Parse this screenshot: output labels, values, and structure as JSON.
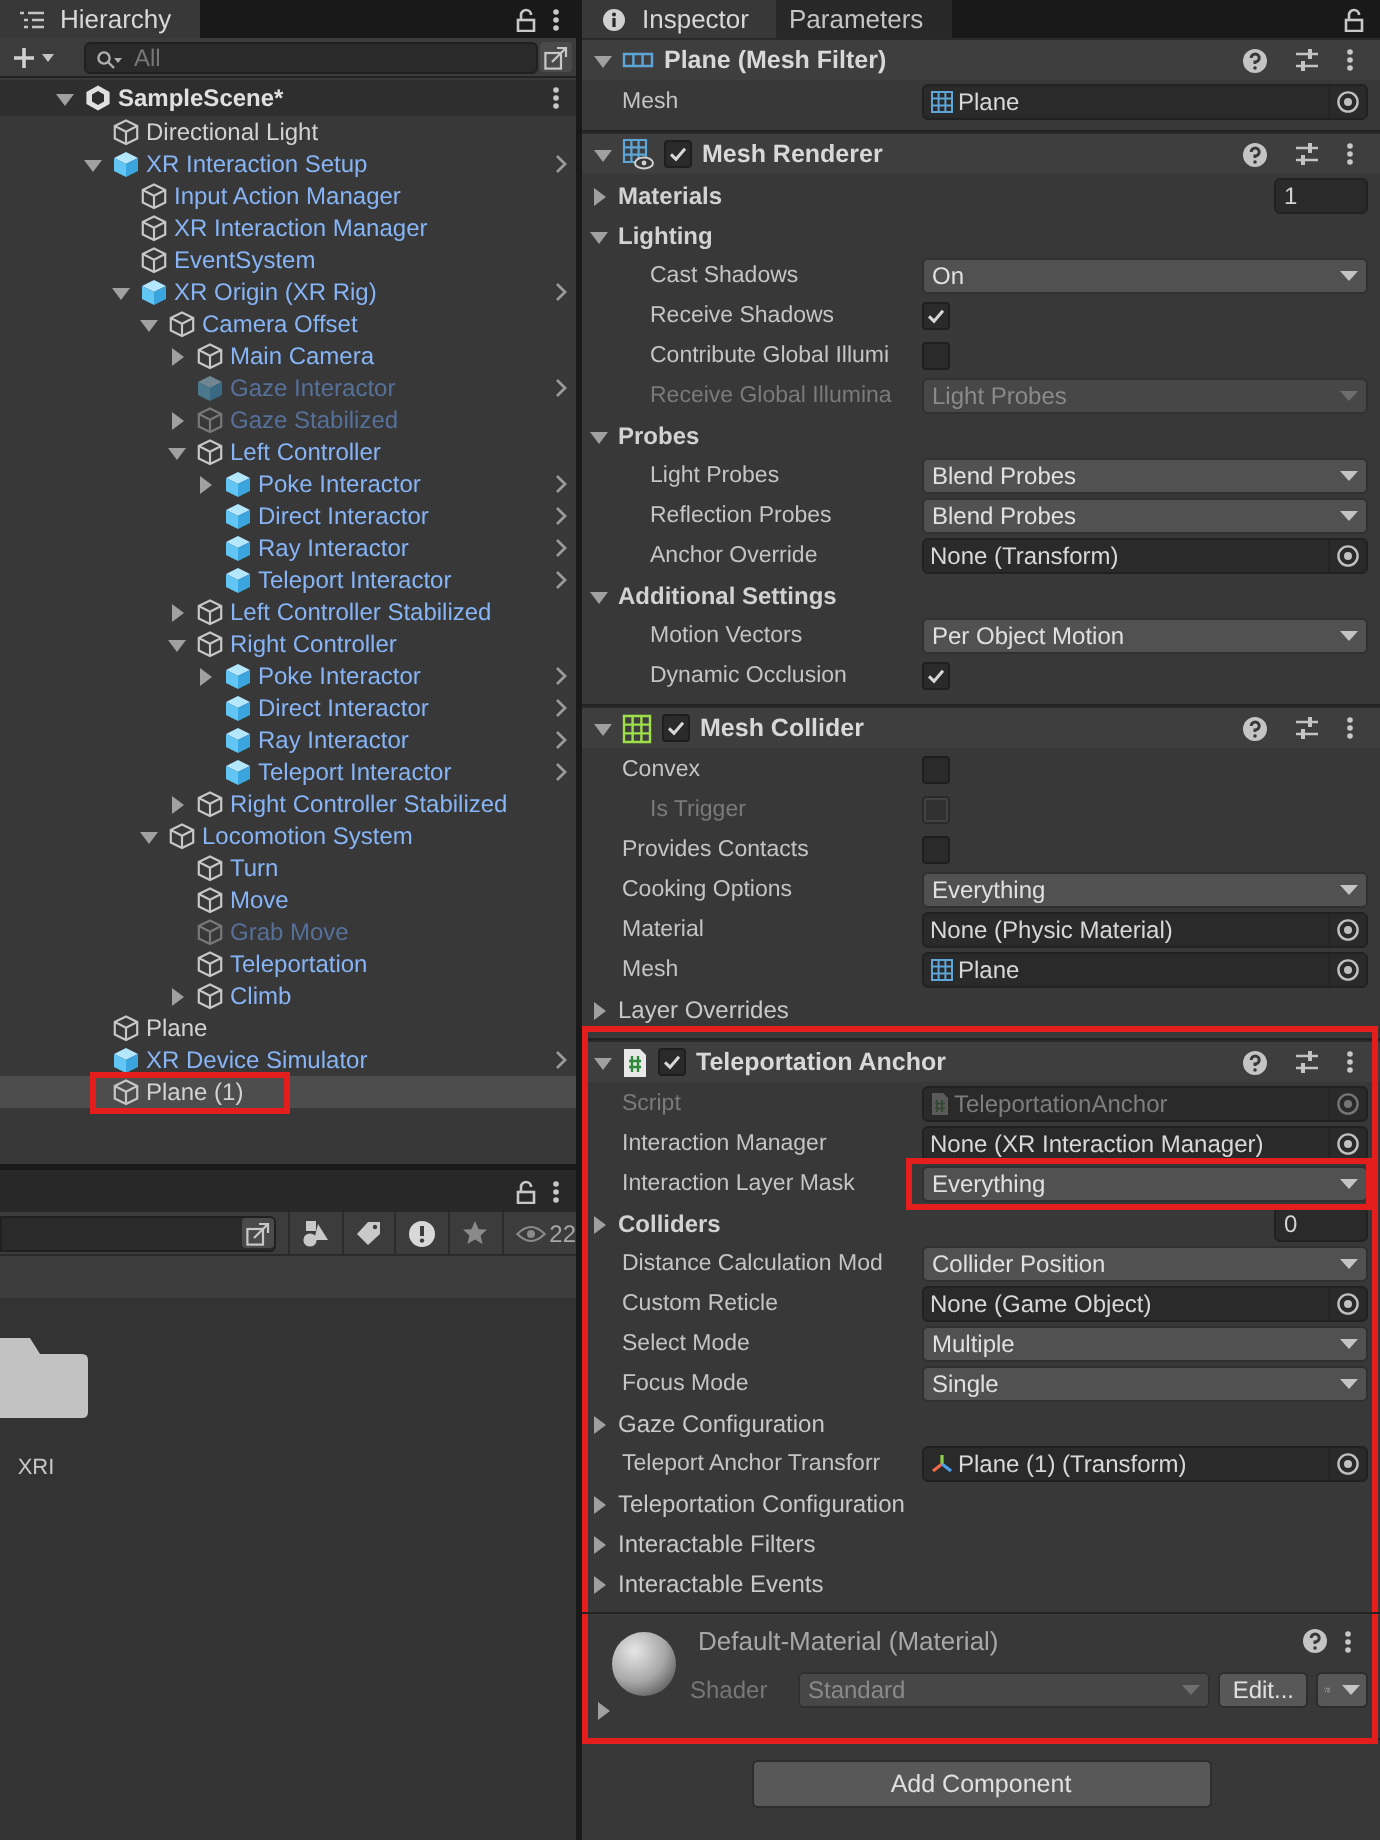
{
  "hierarchy": {
    "tab": {
      "label": "Hierarchy",
      "selected": true
    },
    "search": {
      "placeholder": "All"
    },
    "scene": {
      "name": "SampleScene*",
      "expanded": true,
      "children": [
        {
          "name": "Directional Light",
          "kind": "object",
          "prefab_member": false,
          "active": true,
          "overrides": false,
          "selected": false,
          "annotated": false
        },
        {
          "name": "XR Interaction Setup",
          "kind": "prefab",
          "prefab_member": true,
          "active": true,
          "overrides": true,
          "selected": false,
          "annotated": false,
          "expanded": true,
          "children": [
            {
              "name": "Input Action Manager",
              "kind": "object",
              "prefab_member": true,
              "active": true,
              "overrides": false,
              "selected": false,
              "annotated": false
            },
            {
              "name": "XR Interaction Manager",
              "kind": "object",
              "prefab_member": true,
              "active": true,
              "overrides": false,
              "selected": false,
              "annotated": false
            },
            {
              "name": "EventSystem",
              "kind": "object",
              "prefab_member": true,
              "active": true,
              "overrides": false,
              "selected": false,
              "annotated": false
            },
            {
              "name": "XR Origin (XR Rig)",
              "kind": "prefab",
              "prefab_member": true,
              "active": true,
              "overrides": true,
              "selected": false,
              "annotated": false,
              "expanded": true,
              "children": [
                {
                  "name": "Camera Offset",
                  "kind": "object",
                  "prefab_member": true,
                  "active": true,
                  "overrides": false,
                  "selected": false,
                  "annotated": false,
                  "expanded": true,
                  "children": [
                    {
                      "name": "Main Camera",
                      "kind": "object",
                      "prefab_member": true,
                      "active": true,
                      "overrides": false,
                      "selected": false,
                      "annotated": false,
                      "expanded": false
                    },
                    {
                      "name": "Gaze Interactor",
                      "kind": "prefab",
                      "prefab_member": true,
                      "active": false,
                      "overrides": true,
                      "selected": false,
                      "annotated": false
                    },
                    {
                      "name": "Gaze Stabilized",
                      "kind": "object",
                      "prefab_member": true,
                      "active": false,
                      "overrides": false,
                      "selected": false,
                      "annotated": false,
                      "expanded": false
                    },
                    {
                      "name": "Left Controller",
                      "kind": "object",
                      "prefab_member": true,
                      "active": true,
                      "overrides": false,
                      "selected": false,
                      "annotated": false,
                      "expanded": true,
                      "children": [
                        {
                          "name": "Poke Interactor",
                          "kind": "prefab",
                          "prefab_member": true,
                          "active": true,
                          "overrides": true,
                          "selected": false,
                          "annotated": false,
                          "expanded": false
                        },
                        {
                          "name": "Direct Interactor",
                          "kind": "prefab",
                          "prefab_member": true,
                          "active": true,
                          "overrides": true,
                          "selected": false,
                          "annotated": false
                        },
                        {
                          "name": "Ray Interactor",
                          "kind": "prefab",
                          "prefab_member": true,
                          "active": true,
                          "overrides": true,
                          "selected": false,
                          "annotated": false
                        },
                        {
                          "name": "Teleport Interactor",
                          "kind": "prefab",
                          "prefab_member": true,
                          "active": true,
                          "overrides": true,
                          "selected": false,
                          "annotated": false
                        }
                      ]
                    },
                    {
                      "name": "Left Controller Stabilized",
                      "kind": "object",
                      "prefab_member": true,
                      "active": true,
                      "overrides": false,
                      "selected": false,
                      "annotated": false,
                      "expanded": false
                    },
                    {
                      "name": "Right Controller",
                      "kind": "object",
                      "prefab_member": true,
                      "active": true,
                      "overrides": false,
                      "selected": false,
                      "annotated": false,
                      "expanded": true,
                      "children": [
                        {
                          "name": "Poke Interactor",
                          "kind": "prefab",
                          "prefab_member": true,
                          "active": true,
                          "overrides": true,
                          "selected": false,
                          "annotated": false,
                          "expanded": false
                        },
                        {
                          "name": "Direct Interactor",
                          "kind": "prefab",
                          "prefab_member": true,
                          "active": true,
                          "overrides": true,
                          "selected": false,
                          "annotated": false
                        },
                        {
                          "name": "Ray Interactor",
                          "kind": "prefab",
                          "prefab_member": true,
                          "active": true,
                          "overrides": true,
                          "selected": false,
                          "annotated": false
                        },
                        {
                          "name": "Teleport Interactor",
                          "kind": "prefab",
                          "prefab_member": true,
                          "active": true,
                          "overrides": true,
                          "selected": false,
                          "annotated": false
                        }
                      ]
                    },
                    {
                      "name": "Right Controller Stabilized",
                      "kind": "object",
                      "prefab_member": true,
                      "active": true,
                      "overrides": false,
                      "selected": false,
                      "annotated": false,
                      "expanded": false
                    }
                  ]
                },
                {
                  "name": "Locomotion System",
                  "kind": "object",
                  "prefab_member": true,
                  "active": true,
                  "overrides": false,
                  "selected": false,
                  "annotated": false,
                  "expanded": true,
                  "children": [
                    {
                      "name": "Turn",
                      "kind": "object",
                      "prefab_member": true,
                      "active": true,
                      "overrides": false,
                      "selected": false,
                      "annotated": false
                    },
                    {
                      "name": "Move",
                      "kind": "object",
                      "prefab_member": true,
                      "active": true,
                      "overrides": false,
                      "selected": false,
                      "annotated": false
                    },
                    {
                      "name": "Grab Move",
                      "kind": "object",
                      "prefab_member": true,
                      "active": false,
                      "overrides": false,
                      "selected": false,
                      "annotated": false
                    },
                    {
                      "name": "Teleportation",
                      "kind": "object",
                      "prefab_member": true,
                      "active": true,
                      "overrides": false,
                      "selected": false,
                      "annotated": false
                    },
                    {
                      "name": "Climb",
                      "kind": "object",
                      "prefab_member": true,
                      "active": true,
                      "overrides": false,
                      "selected": false,
                      "annotated": false,
                      "expanded": false
                    }
                  ]
                }
              ]
            }
          ]
        },
        {
          "name": "Plane",
          "kind": "object",
          "prefab_member": false,
          "active": true,
          "overrides": false,
          "selected": false,
          "annotated": false
        },
        {
          "name": "XR Device Simulator",
          "kind": "prefab",
          "prefab_member": true,
          "active": true,
          "overrides": true,
          "selected": false,
          "annotated": false
        },
        {
          "name": "Plane (1)",
          "kind": "object",
          "prefab_member": false,
          "active": true,
          "overrides": false,
          "selected": true,
          "annotated": true
        }
      ]
    }
  },
  "project": {
    "filter_count": "22",
    "items": [
      {
        "name": "XRI",
        "kind": "folder"
      }
    ]
  },
  "inspector": {
    "tabs": [
      {
        "label": "Inspector",
        "selected": true
      },
      {
        "label": "Parameters",
        "selected": false
      }
    ],
    "components": [
      {
        "kind": "mesh_filter",
        "title": "Plane (Mesh Filter)",
        "expanded": true,
        "annotated": false,
        "properties": [
          {
            "kind": "object",
            "label": "Mesh",
            "value": "Plane",
            "asset": {
              "kind": "mesh"
            },
            "disabled": false,
            "annotated": false
          }
        ]
      },
      {
        "kind": "mesh_renderer",
        "title": "Mesh Renderer",
        "enabled": true,
        "expanded": true,
        "annotated": false,
        "properties": [
          {
            "kind": "foldout",
            "label": "Materials",
            "bold": true,
            "expanded": false,
            "value": "1"
          },
          {
            "kind": "foldout",
            "label": "Lighting",
            "bold": true,
            "expanded": true,
            "children": [
              {
                "kind": "dropdown",
                "label": "Cast Shadows",
                "value": "On",
                "disabled": false,
                "annotated": false
              },
              {
                "kind": "checkbox",
                "label": "Receive Shadows",
                "checked": true,
                "disabled": false
              },
              {
                "kind": "checkbox",
                "label": "Contribute Global Illumi",
                "checked": false,
                "disabled": false
              },
              {
                "kind": "dropdown",
                "label": "Receive Global Illumina",
                "value": "Light Probes",
                "disabled": true,
                "annotated": false
              }
            ]
          },
          {
            "kind": "foldout",
            "label": "Probes",
            "bold": true,
            "expanded": true,
            "children": [
              {
                "kind": "dropdown",
                "label": "Light Probes",
                "value": "Blend Probes",
                "disabled": false,
                "annotated": false
              },
              {
                "kind": "dropdown",
                "label": "Reflection Probes",
                "value": "Blend Probes",
                "disabled": false,
                "annotated": false
              },
              {
                "kind": "object",
                "label": "Anchor Override",
                "value": "None (Transform)",
                "disabled": false,
                "annotated": false
              }
            ]
          },
          {
            "kind": "foldout",
            "label": "Additional Settings",
            "bold": true,
            "expanded": true,
            "children": [
              {
                "kind": "dropdown",
                "label": "Motion Vectors",
                "value": "Per Object Motion",
                "disabled": false,
                "annotated": false
              },
              {
                "kind": "checkbox",
                "label": "Dynamic Occlusion",
                "checked": true,
                "disabled": false
              }
            ]
          }
        ]
      },
      {
        "kind": "mesh_collider",
        "title": "Mesh Collider",
        "enabled": true,
        "expanded": true,
        "annotated": false,
        "properties": [
          {
            "kind": "checkbox",
            "label": "Convex",
            "checked": false,
            "disabled": false,
            "children": [
              {
                "kind": "checkbox",
                "label": "Is Trigger",
                "checked": false,
                "disabled": true
              }
            ]
          },
          {
            "kind": "checkbox",
            "label": "Provides Contacts",
            "checked": false,
            "disabled": false
          },
          {
            "kind": "dropdown",
            "label": "Cooking Options",
            "value": "Everything",
            "disabled": false,
            "annotated": false
          },
          {
            "kind": "object",
            "label": "Material",
            "value": "None (Physic Material)",
            "disabled": false,
            "annotated": false
          },
          {
            "kind": "object",
            "label": "Mesh",
            "value": "Plane",
            "asset": {
              "kind": "mesh"
            },
            "disabled": false,
            "annotated": false
          },
          {
            "kind": "foldout",
            "label": "Layer Overrides",
            "bold": false,
            "expanded": false
          }
        ]
      },
      {
        "kind": "script",
        "title": "Teleportation Anchor",
        "enabled": true,
        "expanded": true,
        "annotated": true,
        "properties": [
          {
            "kind": "object",
            "label": "Script",
            "value": "TeleportationAnchor",
            "asset": {
              "kind": "script"
            },
            "disabled": true,
            "annotated": false
          },
          {
            "kind": "object",
            "label": "Interaction Manager",
            "value": "None (XR Interaction Manager)",
            "disabled": false,
            "annotated": false
          },
          {
            "kind": "dropdown",
            "label": "Interaction Layer Mask",
            "value": "Everything",
            "disabled": false,
            "annotated": true
          },
          {
            "kind": "foldout",
            "label": "Colliders",
            "bold": true,
            "expanded": false,
            "value": "0"
          },
          {
            "kind": "dropdown",
            "label": "Distance Calculation Mod",
            "value": "Collider Position",
            "disabled": false,
            "annotated": false
          },
          {
            "kind": "object",
            "label": "Custom Reticle",
            "value": "None (Game Object)",
            "disabled": false,
            "annotated": false
          },
          {
            "kind": "dropdown",
            "label": "Select Mode",
            "value": "Multiple",
            "disabled": false,
            "annotated": false
          },
          {
            "kind": "dropdown",
            "label": "Focus Mode",
            "value": "Single",
            "disabled": false,
            "annotated": false
          },
          {
            "kind": "foldout",
            "label": "Gaze Configuration",
            "bold": false,
            "expanded": false
          },
          {
            "kind": "object",
            "label": "Teleport Anchor Transforr",
            "value": "Plane (1) (Transform)",
            "asset": {
              "kind": "transform"
            },
            "disabled": false,
            "annotated": false
          },
          {
            "kind": "foldout",
            "label": "Teleportation Configuration",
            "bold": false,
            "expanded": false
          },
          {
            "kind": "foldout",
            "label": "Interactable Filters",
            "bold": false,
            "expanded": false
          },
          {
            "kind": "foldout",
            "label": "Interactable Events",
            "bold": false,
            "expanded": false
          }
        ]
      }
    ],
    "material": {
      "title": "Default-Material (Material)",
      "shader_label": "Shader",
      "shader": "Standard",
      "edit_button": "Edit...",
      "expanded": false,
      "annotated": true
    },
    "add_button": "Add Component"
  }
}
